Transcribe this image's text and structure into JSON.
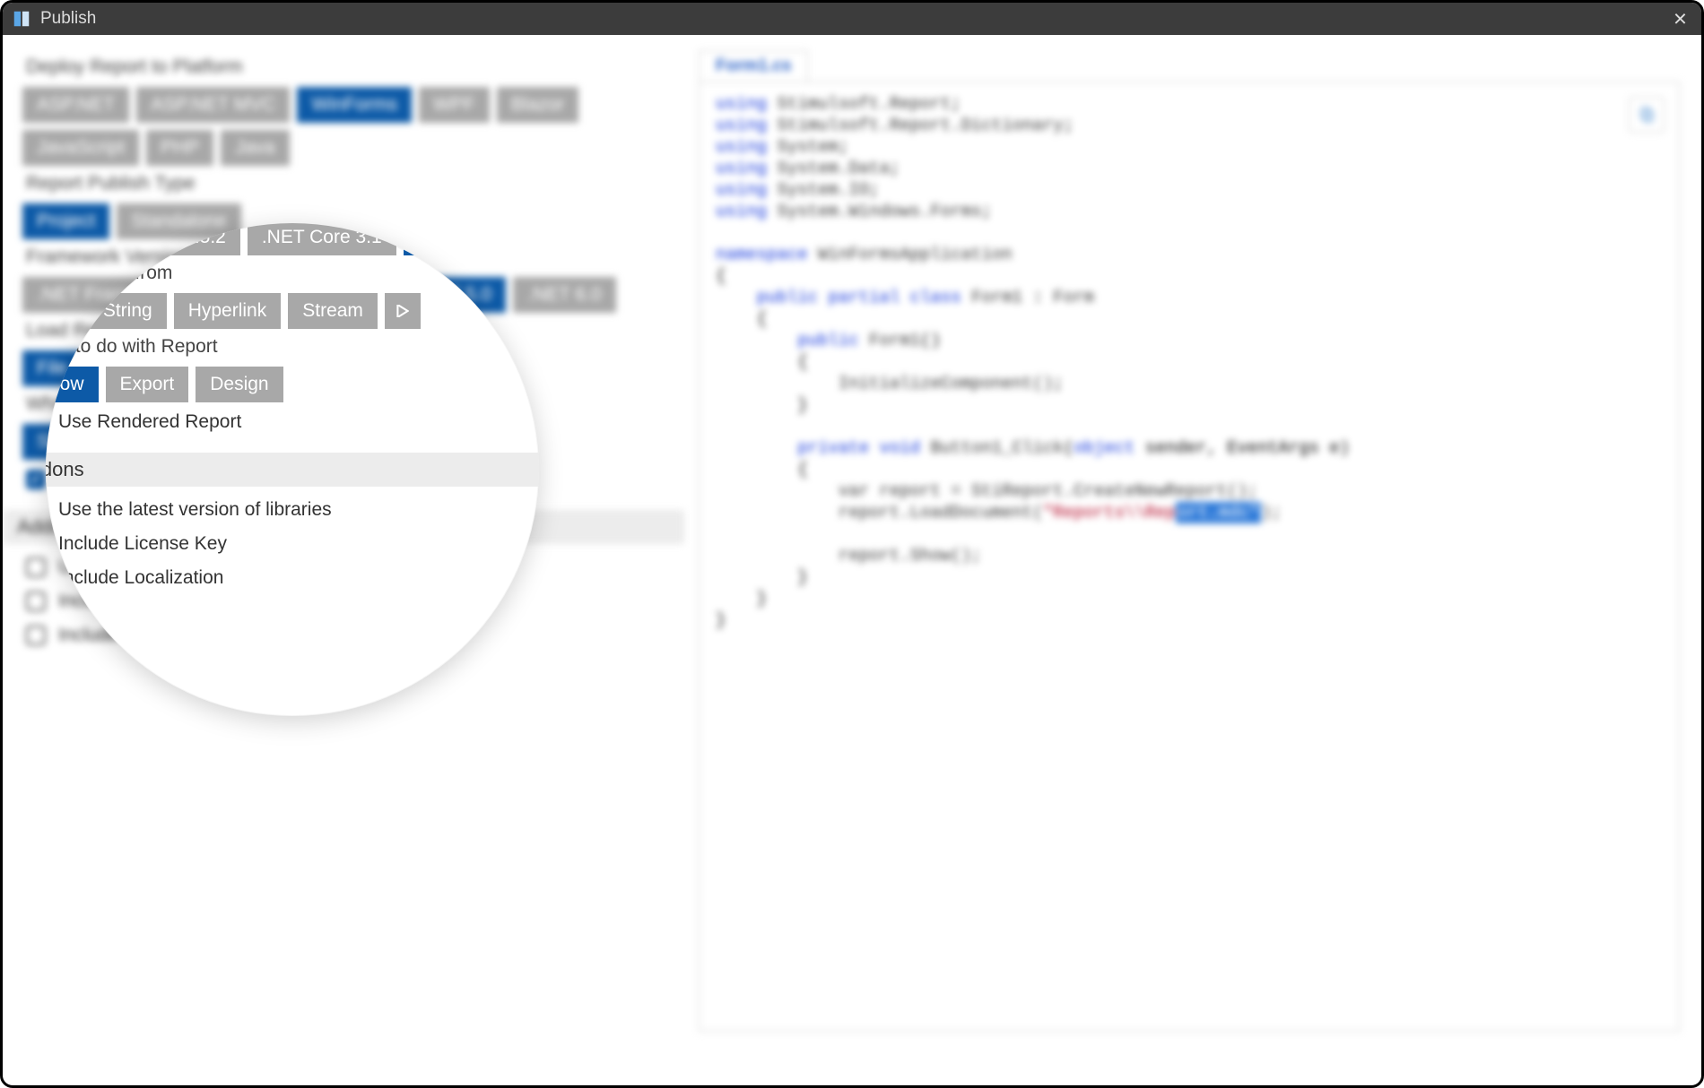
{
  "window": {
    "title": "Publish"
  },
  "sections": {
    "deploy_label": "Deploy Report to Platform",
    "publish_type_label": "Report Publish Type",
    "framework_label": "Framework Version",
    "load_label": "Load Report from",
    "action_label": "What to do with Report",
    "addons_label": "Addons"
  },
  "deploy": {
    "items": [
      "ASP.NET",
      "ASP.NET MVC",
      "WinForms",
      "WPF",
      "Blazor",
      "JavaScript",
      "PHP",
      "Java"
    ],
    "active": "WinForms"
  },
  "publish_type": {
    "items": [
      "Project",
      "Standalone"
    ],
    "active": "Project"
  },
  "framework": {
    "items": [
      ".NET Framework 4.5.2",
      ".NET Core 3.1",
      ".NET 5.0",
      ".NET 6.0"
    ],
    "active": ".NET 5.0"
  },
  "load_from": {
    "items": [
      "File",
      "String",
      "Hyperlink",
      "Stream",
      "▷"
    ],
    "active": "File"
  },
  "action": {
    "items": [
      "Show",
      "Export",
      "Design"
    ],
    "active": "Show"
  },
  "use_rendered": {
    "label": "Use Rendered Report",
    "checked": true
  },
  "addons": [
    {
      "label": "Use the latest version of libraries",
      "checked": false
    },
    {
      "label": "Include License Key",
      "checked": false
    },
    {
      "label": "Include Localization",
      "checked": false
    }
  ],
  "code_tab": "Form1.cs",
  "code": {
    "usings": [
      "Stimulsoft.Report",
      "Stimulsoft.Report.Dictionary",
      "System",
      "System.Data",
      "System.IO",
      "System.Windows.Forms"
    ],
    "namespace": "WinFormsApplication",
    "class": "Form1",
    "base": "Form",
    "ctor": "Form1",
    "init_call": "InitializeComponent()",
    "handler": "Button1_Click",
    "handler_args": "object sender, EventArgs e",
    "var_decl": "var report = StiReport.CreateNewReport();",
    "load_prefix": "report.LoadDocument(",
    "string_a": "\"Reports\\\\Rep",
    "string_b": "ort.mdc\"",
    "load_suffix": ");",
    "show": "report.Show();"
  }
}
